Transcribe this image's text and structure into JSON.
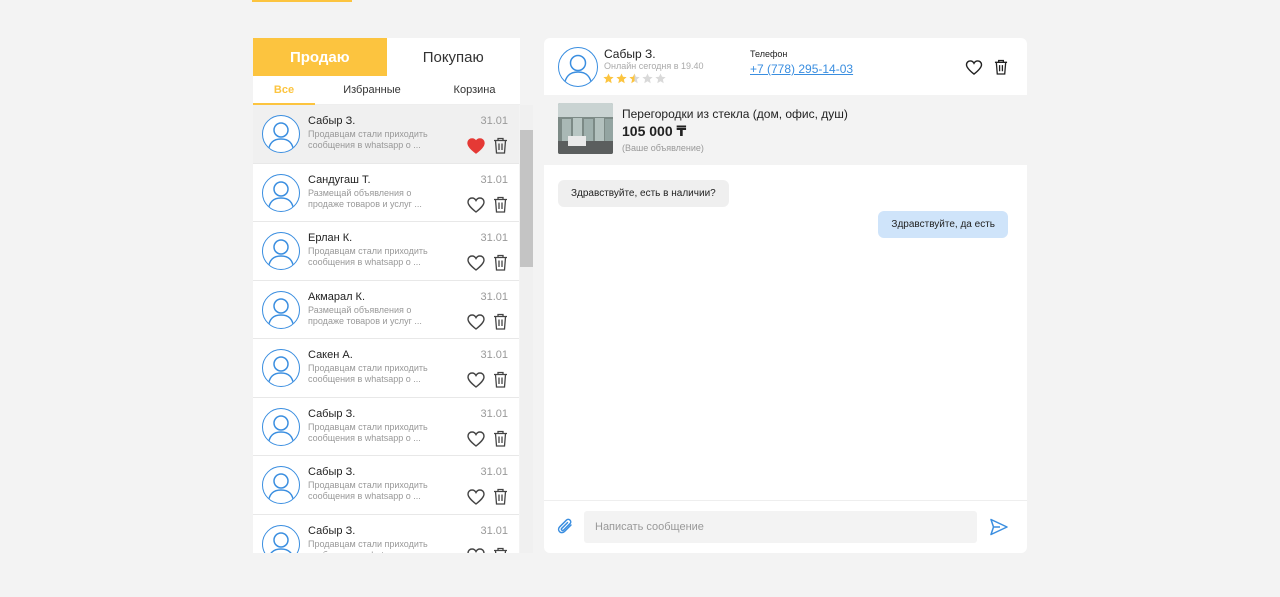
{
  "tabs": {
    "sell": "Продаю",
    "buy": "Покупаю"
  },
  "filters": {
    "all": "Все",
    "favorites": "Избранные",
    "cart": "Корзина"
  },
  "chats": [
    {
      "name": "Сабыр З.",
      "preview": "Продавцам стали приходить сообщения в whatsapp о ...",
      "date": "31.01",
      "liked": true
    },
    {
      "name": "Сандугаш Т.",
      "preview": "Размещай объявления о продаже товаров и услуг ...",
      "date": "31.01",
      "liked": false
    },
    {
      "name": "Ерлан К.",
      "preview": "Продавцам стали приходить сообщения в whatsapp о ...",
      "date": "31.01",
      "liked": false
    },
    {
      "name": "Акмарал К.",
      "preview": "Размещай объявления о продаже товаров и услуг ...",
      "date": "31.01",
      "liked": false
    },
    {
      "name": "Сакен А.",
      "preview": "Продавцам стали приходить сообщения в whatsapp о ...",
      "date": "31.01",
      "liked": false
    },
    {
      "name": "Сабыр З.",
      "preview": "Продавцам стали приходить сообщения в whatsapp о ...",
      "date": "31.01",
      "liked": false
    },
    {
      "name": "Сабыр З.",
      "preview": "Продавцам стали приходить сообщения в whatsapp о ...",
      "date": "31.01",
      "liked": false
    },
    {
      "name": "Сабыр З.",
      "preview": "Продавцам стали приходить сообщения в whatsapp о ...",
      "date": "31.01",
      "liked": false
    }
  ],
  "conversation": {
    "name": "Сабыр З.",
    "status": "Онлайн сегодня в 19.40",
    "rating": 2.5,
    "rating_max": 5,
    "phone_label": "Телефон",
    "phone": "+7 (778) 295-14-03",
    "listing": {
      "title": "Перегородки из стекла (дом, офис, душ)",
      "price": "105 000 ₸",
      "note": "(Ваше объявление)"
    },
    "messages": [
      {
        "dir": "in",
        "text": "Здравствуйте, есть в наличии?"
      },
      {
        "dir": "out",
        "text": "Здравствуйте, да есть"
      }
    ],
    "composer_placeholder": "Написать сообщение"
  },
  "colors": {
    "accent": "#fcc43f",
    "link": "#3a8ee0",
    "liked": "#e53935",
    "outgoing_bubble": "#cfe4fa"
  },
  "icons": [
    "user-icon",
    "heart-icon",
    "trash-icon",
    "star-icon",
    "paperclip-icon",
    "send-icon"
  ]
}
